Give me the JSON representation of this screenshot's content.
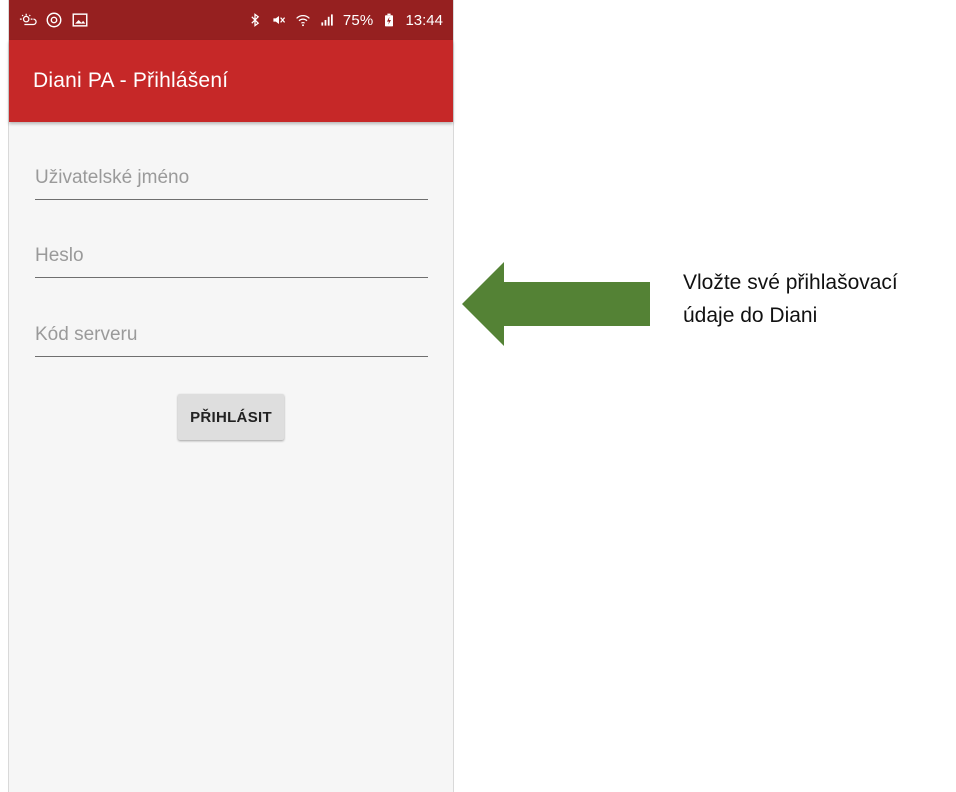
{
  "status_bar": {
    "left_icons": [
      "weather-icon",
      "circle-status-icon",
      "gallery-icon"
    ],
    "right_icons": [
      "bluetooth-icon",
      "mute-icon",
      "wifi-icon",
      "signal-icon"
    ],
    "battery": "75%",
    "time": "13:44",
    "color": "#962020"
  },
  "app_bar": {
    "title": "Diani PA - Přihlášení",
    "color": "#c62828"
  },
  "form": {
    "username_placeholder": "Uživatelské jméno",
    "password_placeholder": "Heslo",
    "server_placeholder": "Kód serveru",
    "login_label": "PŘIHLÁSIT"
  },
  "annotation": {
    "arrow_color": "#548235",
    "line1": "Vložte své přihlašovací",
    "line2": "údaje do Diani"
  }
}
